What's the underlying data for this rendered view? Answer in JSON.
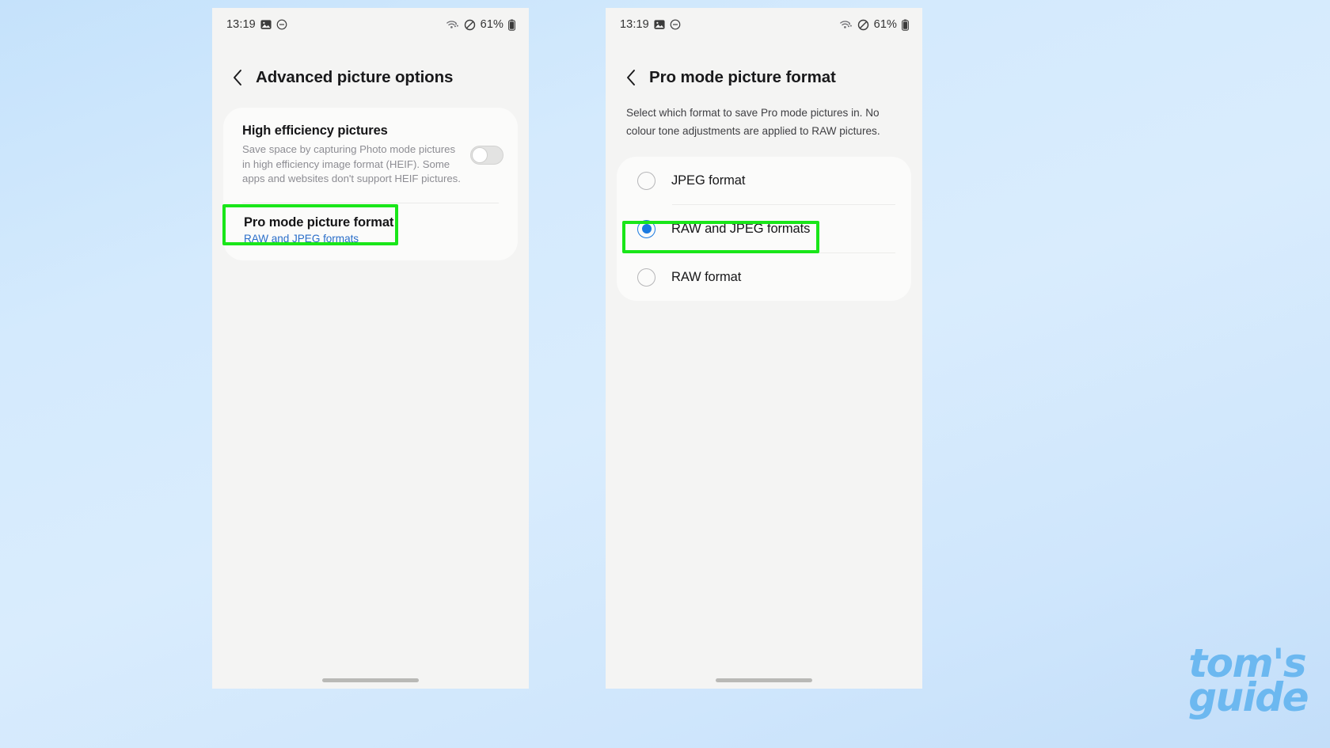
{
  "background": {
    "color_top": "#c5e2fb",
    "color_bottom": "#c3def9"
  },
  "highlight_color": "#19e619",
  "accent_color": "#1a7ae0",
  "link_color": "#2a6ec9",
  "statusbar": {
    "time": "13:19",
    "battery_percent": "61%",
    "icons": [
      "photo-icon",
      "do-not-disturb-icon",
      "wifi-icon",
      "mute-icon",
      "battery-icon"
    ]
  },
  "phone_left": {
    "title": "Advanced picture options",
    "back_label": "Back",
    "toggle_setting": {
      "title": "High efficiency pictures",
      "description": "Save space by capturing Photo mode pictures in high efficiency image format (HEIF). Some apps and websites don't support HEIF pictures.",
      "state": "off"
    },
    "link_setting": {
      "title": "Pro mode picture format",
      "value": "RAW and JPEG formats",
      "highlighted": true
    }
  },
  "phone_right": {
    "title": "Pro mode picture format",
    "back_label": "Back",
    "description": "Select which format to save Pro mode pictures in. No colour tone adjustments are applied to RAW pictures.",
    "options": [
      {
        "label": "JPEG format",
        "selected": false,
        "highlighted": false
      },
      {
        "label": "RAW and JPEG formats",
        "selected": true,
        "highlighted": true
      },
      {
        "label": "RAW format",
        "selected": false,
        "highlighted": false
      }
    ]
  },
  "watermark": {
    "line1": "tom's",
    "line2": "guide",
    "color": "#6cb8f0"
  }
}
